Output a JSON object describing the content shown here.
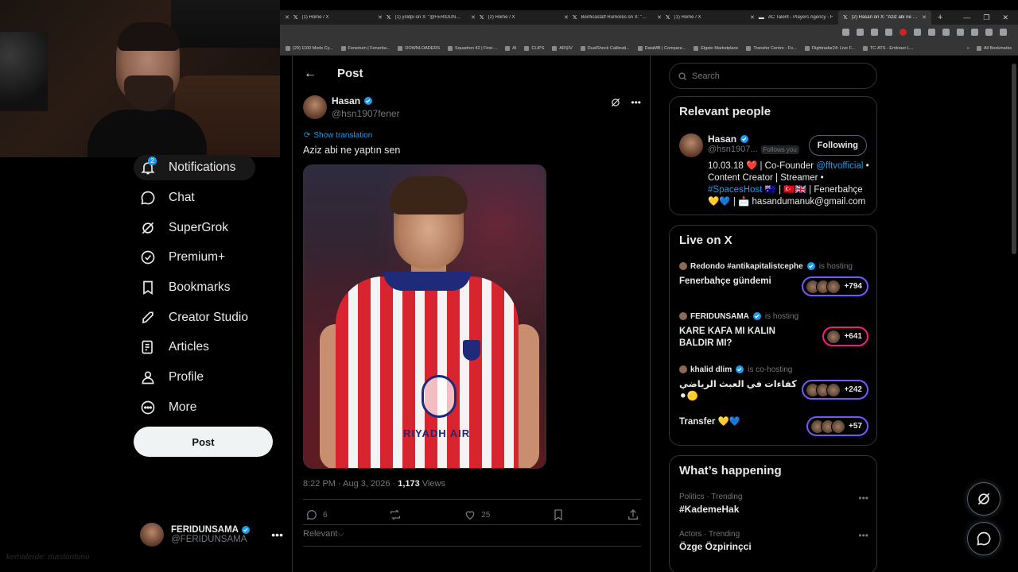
{
  "browser": {
    "tabs": [
      {
        "label": "(1) Home / X",
        "active": false
      },
      {
        "label": "(1) ysldpi on X: \"@FERIDUNSAMA...",
        "active": false
      },
      {
        "label": "(2) Home / X",
        "active": false
      },
      {
        "label": "Benficastaff Rumores on X: \"C...",
        "active": false
      },
      {
        "label": "(1) Home / X",
        "active": false
      },
      {
        "label": "AC Talent - Players Agency - F",
        "active": false
      },
      {
        "label": "(2) Hasan on X: \"Aziz abi ne y...",
        "active": true
      }
    ],
    "bookmarks": [
      "(29) 1100 Mods Cy...",
      "Fenerium | Fenerba...",
      "DOWNLOADERS",
      "Squadron 42 | First-...",
      "AI",
      "CLIPS",
      "ARŞİV",
      "DualShock Calibrati...",
      "DataMB | Compare...",
      "Elgato Marketplace",
      "Transfer Centre - Fo...",
      "Flightradar24: Live F...",
      "TC-ATS - Embraer L..."
    ],
    "all_bookmarks": "All Bookmarks"
  },
  "nav": {
    "items": [
      {
        "label": "Notifications",
        "icon": "bell-icon",
        "badge": "2"
      },
      {
        "label": "Chat",
        "icon": "chat-icon"
      },
      {
        "label": "SuperGrok",
        "icon": "grok-icon"
      },
      {
        "label": "Premium+",
        "icon": "verified-icon"
      },
      {
        "label": "Bookmarks",
        "icon": "bookmark-icon"
      },
      {
        "label": "Creator Studio",
        "icon": "rocket-icon"
      },
      {
        "label": "Articles",
        "icon": "article-icon"
      },
      {
        "label": "Profile",
        "icon": "profile-icon"
      },
      {
        "label": "More",
        "icon": "more-icon"
      }
    ],
    "post_button": "Post",
    "account": {
      "name": "FERIDUNSAMA",
      "handle": "@FERIDUNSAMA"
    }
  },
  "watermark": "kemalerde: mastontuno",
  "post": {
    "header_title": "Post",
    "author_name": "Hasan",
    "author_handle": "@hsn1907fener",
    "show_translation": "Show translation",
    "text": "Aziz abi ne yaptın sen",
    "time": "8:22 PM · Aug 3, 2026 · ",
    "views_count": "1,173",
    "views_label": " Views",
    "replies": "6",
    "likes": "25",
    "relevant_label": "Relevant",
    "media_sponsor": "RIYADH AIR"
  },
  "search": {
    "placeholder": "Search"
  },
  "relevant_people": {
    "title": "Relevant people",
    "name": "Hasan",
    "handle": "@hsn1907...",
    "follows_you": "Follows you",
    "follow_button": "Following",
    "bio_part1": "10.03.18 ❤️ | Co-Founder ",
    "bio_link1": "@fftvofficial",
    "bio_part2": " • Content Creator | Streamer • ",
    "bio_link2": "#SpacesHost",
    "bio_part3": " 🇦🇺 | 🇹🇷🇬🇧 | Fenerbahçe 💛💙 | 📩 hasandumanuk@gmail.com"
  },
  "live": {
    "title": "Live on X",
    "items": [
      {
        "host": "Redondo #antikapitalistcephe",
        "role": "is hosting",
        "topic": "Fenerbahçe gündemi",
        "count": "+794",
        "color": "purple"
      },
      {
        "host": "FERIDUNSAMA",
        "role": "is hosting",
        "topic": "KARE KAFA MI KALIN BALDIR MI?",
        "count": "+641",
        "color": "pink"
      },
      {
        "host": "khalid dlim",
        "role": "is co-hosting",
        "topic": "كفاءات في العبث الرياضي ⚫🟡",
        "count": "+242",
        "color": "purple"
      },
      {
        "host": "",
        "role": "",
        "topic": "Transfer 💛💙",
        "count": "+57",
        "color": "purple"
      }
    ]
  },
  "happening": {
    "title": "What’s happening",
    "trends": [
      {
        "category": "Politics · Trending",
        "name": "#KademeHak"
      },
      {
        "category": "Actors · Trending",
        "name": "Özge Özpirinçci"
      }
    ]
  },
  "colors": {
    "accent": "#1d9bf0",
    "background": "#000000",
    "border": "#2f3336",
    "live_purple": "#7856ff",
    "live_pink": "#f91880"
  }
}
